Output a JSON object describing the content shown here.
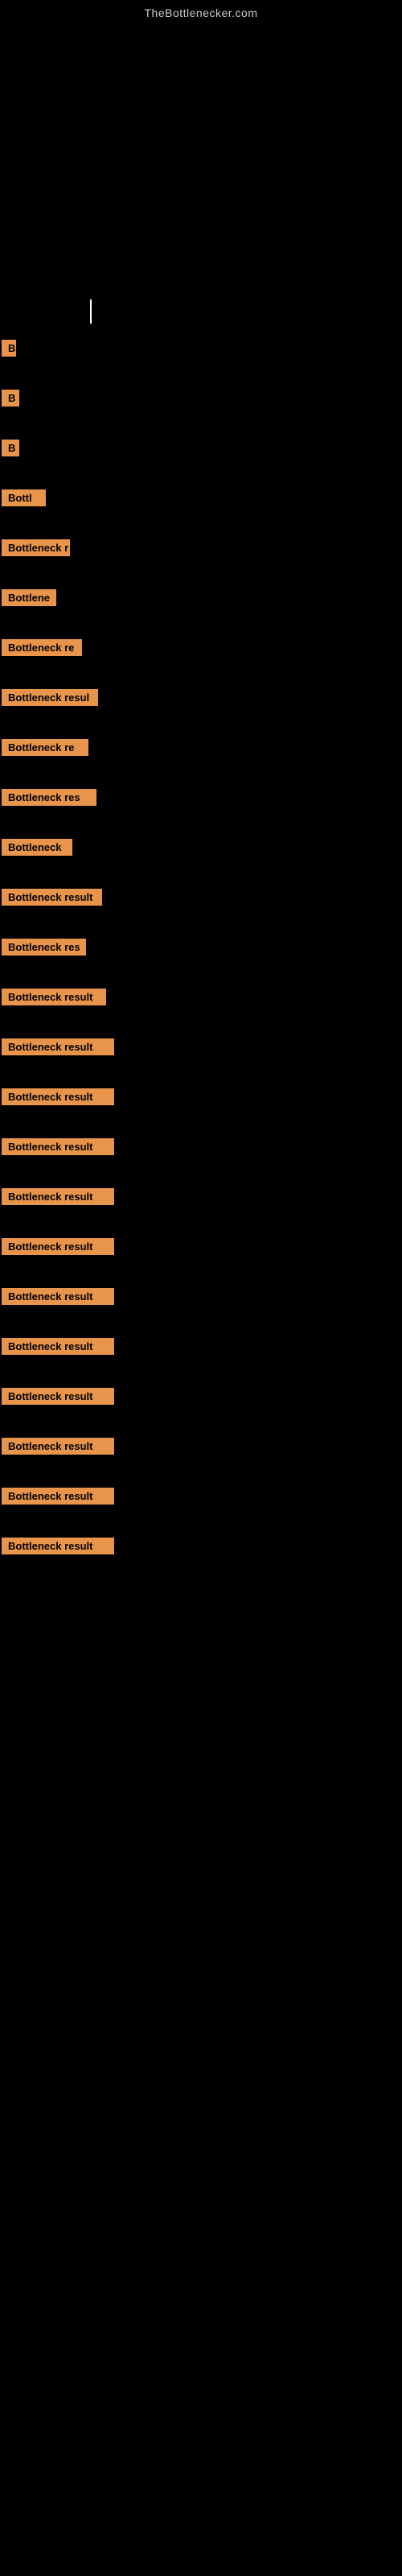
{
  "site": {
    "title": "TheBottlenecker.com"
  },
  "labels": [
    {
      "id": 1,
      "text": "B",
      "widthClass": "label-w1"
    },
    {
      "id": 2,
      "text": "B",
      "widthClass": "label-w2"
    },
    {
      "id": 3,
      "text": "B",
      "widthClass": "label-w3"
    },
    {
      "id": 4,
      "text": "Bottl",
      "widthClass": "label-w4"
    },
    {
      "id": 5,
      "text": "Bottleneck r",
      "widthClass": "label-w5"
    },
    {
      "id": 6,
      "text": "Bottlene",
      "widthClass": "label-w6"
    },
    {
      "id": 7,
      "text": "Bottleneck re",
      "widthClass": "label-w7"
    },
    {
      "id": 8,
      "text": "Bottleneck resul",
      "widthClass": "label-w8"
    },
    {
      "id": 9,
      "text": "Bottleneck re",
      "widthClass": "label-w9"
    },
    {
      "id": 10,
      "text": "Bottleneck res",
      "widthClass": "label-w10"
    },
    {
      "id": 11,
      "text": "Bottleneck",
      "widthClass": "label-w11"
    },
    {
      "id": 12,
      "text": "Bottleneck result",
      "widthClass": "label-w12"
    },
    {
      "id": 13,
      "text": "Bottleneck res",
      "widthClass": "label-w13"
    },
    {
      "id": 14,
      "text": "Bottleneck result",
      "widthClass": "label-w14"
    },
    {
      "id": 15,
      "text": "Bottleneck result",
      "widthClass": "label-w15"
    },
    {
      "id": 16,
      "text": "Bottleneck result",
      "widthClass": "label-w16"
    },
    {
      "id": 17,
      "text": "Bottleneck result",
      "widthClass": "label-w17"
    },
    {
      "id": 18,
      "text": "Bottleneck result",
      "widthClass": "label-w18"
    },
    {
      "id": 19,
      "text": "Bottleneck result",
      "widthClass": "label-w19"
    },
    {
      "id": 20,
      "text": "Bottleneck result",
      "widthClass": "label-w20"
    },
    {
      "id": 21,
      "text": "Bottleneck result",
      "widthClass": "label-w21"
    },
    {
      "id": 22,
      "text": "Bottleneck result",
      "widthClass": "label-w22"
    },
    {
      "id": 23,
      "text": "Bottleneck result",
      "widthClass": "label-w23"
    },
    {
      "id": 24,
      "text": "Bottleneck result",
      "widthClass": "label-w24"
    },
    {
      "id": 25,
      "text": "Bottleneck result",
      "widthClass": "label-w25"
    }
  ]
}
